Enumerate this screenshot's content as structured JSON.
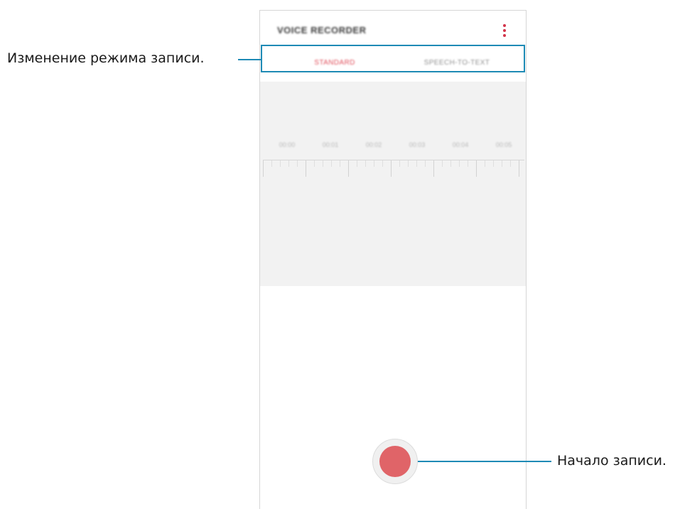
{
  "app": {
    "title": "VOICE RECORDER",
    "menu_icon": "more-vertical-icon"
  },
  "tabs": [
    {
      "label": "STANDARD",
      "active": true
    },
    {
      "label": "SPEECH-TO-TEXT",
      "active": false
    }
  ],
  "timeline": {
    "labels": [
      "00:00",
      "00:01",
      "00:02",
      "00:03",
      "00:04",
      "00:05"
    ]
  },
  "record_button": {
    "icon": "record-icon",
    "color": "#e06468"
  },
  "annotations": {
    "mode_change": "Изменение режима записи.",
    "start_recording": "Начало записи."
  },
  "colors": {
    "accent": "#e05562",
    "callout": "#1e8ab5"
  }
}
